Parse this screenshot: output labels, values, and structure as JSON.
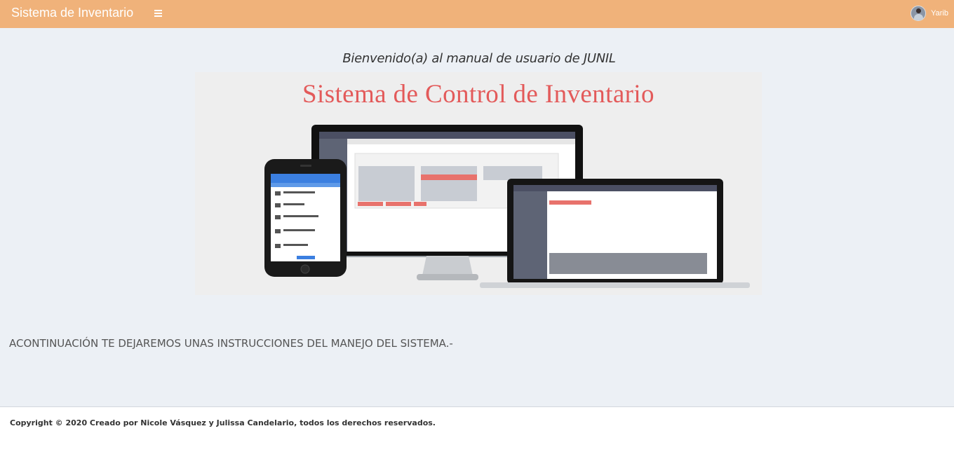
{
  "header": {
    "brand": "Sistema de Inventario",
    "user_name": "Yarib"
  },
  "main": {
    "welcome": "Bienvenido(a) al manual de usuario de JUNIL",
    "banner_title": "Sistema de Control de Inventario",
    "instructions": "ACONTINUACIÓN TE DEJAREMOS UNAS INSTRUCCIONES DEL MANEJO DEL SISTEMA.-"
  },
  "footer": {
    "copyright": "Copyright © 2020 Creado por Nicole Vásquez y Julissa Candelario, todos los derechos reservados."
  },
  "colors": {
    "navbar": "#f0b27a",
    "background": "#ecf0f5",
    "banner_title": "#e35a5a"
  }
}
